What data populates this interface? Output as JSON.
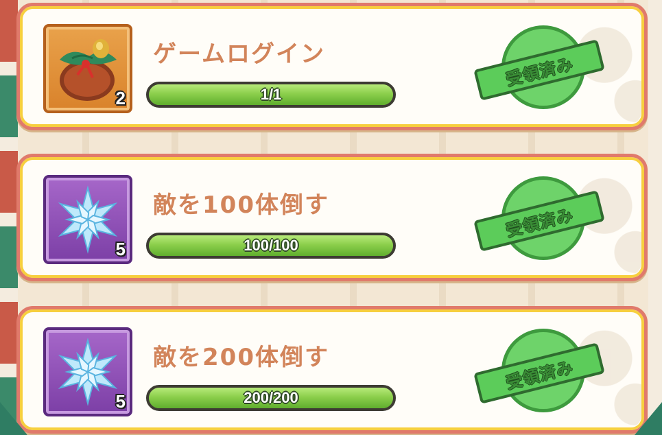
{
  "missions": [
    {
      "title": "ゲームログイン",
      "progress_text": "1/1",
      "progress": 1.0,
      "reward_icon": "christmas-bag-icon",
      "reward_qty": "2",
      "frame_color": "orange",
      "status": "受領済み"
    },
    {
      "title": "敵を100体倒す",
      "progress_text": "100/100",
      "progress": 1.0,
      "reward_icon": "snowflake-crystal-icon",
      "reward_qty": "5",
      "frame_color": "purple",
      "status": "受領済み"
    },
    {
      "title": "敵を200体倒す",
      "progress_text": "200/200",
      "progress": 1.0,
      "reward_icon": "snowflake-crystal-icon",
      "reward_qty": "5",
      "frame_color": "purple",
      "status": "受領済み"
    }
  ],
  "colors": {
    "card_border": "#e07a6b",
    "card_inner_border": "#f7cf3e",
    "title_text": "#d2845a",
    "bar_fill": "#8ccf4c",
    "stamp_green": "#5ccc5a"
  }
}
